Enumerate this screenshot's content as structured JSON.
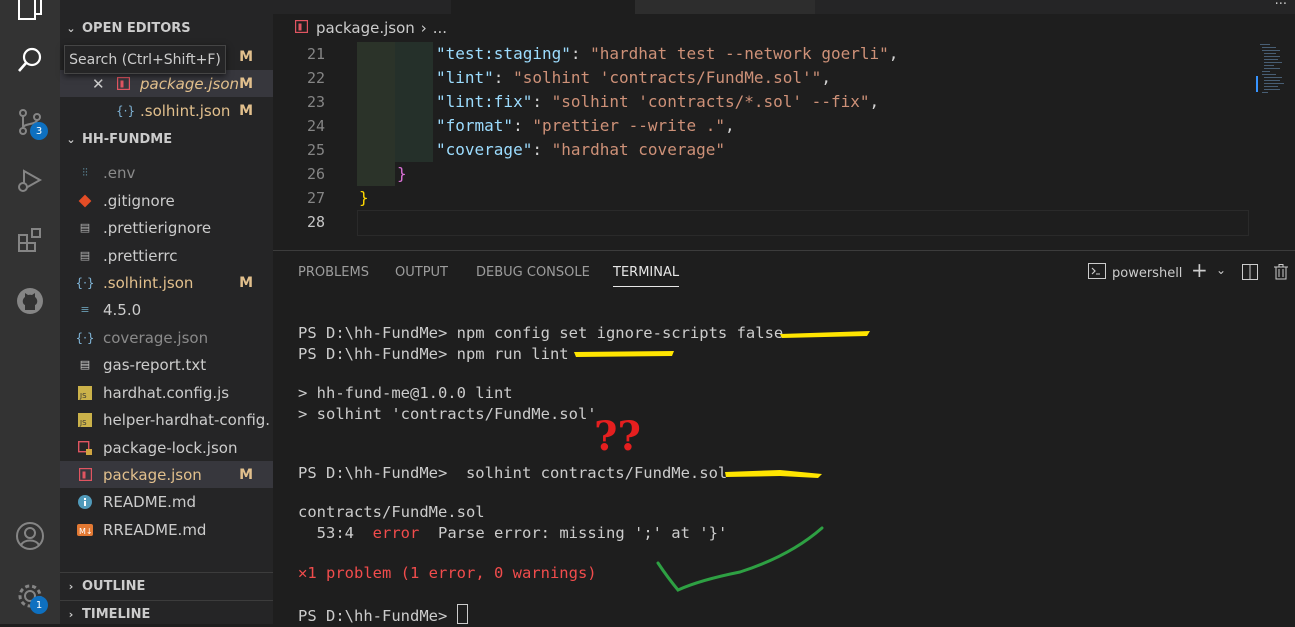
{
  "tooltip": "Search (Ctrl+Shift+F)",
  "activity": {
    "scm_badge": "3",
    "settings_badge": "1"
  },
  "sidebar": {
    "open_editors_title": "OPEN EDITORS",
    "open_editors": [
      {
        "label": "package.json",
        "status": "M",
        "partial_status": "M"
      },
      {
        "label": "package.json",
        "status": "M"
      },
      {
        "label": ".solhint.json",
        "status": "M"
      }
    ],
    "project_title": "HH-FUNDME",
    "files": [
      {
        "label": ".env",
        "status": ""
      },
      {
        "label": ".gitignore",
        "status": ""
      },
      {
        "label": ".prettierignore",
        "status": ""
      },
      {
        "label": ".prettierrc",
        "status": ""
      },
      {
        "label": ".solhint.json",
        "status": "M"
      },
      {
        "label": "4.5.0",
        "status": ""
      },
      {
        "label": "coverage.json",
        "status": ""
      },
      {
        "label": "gas-report.txt",
        "status": ""
      },
      {
        "label": "hardhat.config.js",
        "status": ""
      },
      {
        "label": "helper-hardhat-config...",
        "status": ""
      },
      {
        "label": "package-lock.json",
        "status": ""
      },
      {
        "label": "package.json",
        "status": "M"
      },
      {
        "label": "README.md",
        "status": ""
      },
      {
        "label": "RREADME.md",
        "status": ""
      }
    ],
    "outline_title": "OUTLINE",
    "timeline_title": "TIMELINE"
  },
  "breadcrumb": {
    "file": "package.json",
    "sep": "›",
    "rest": "..."
  },
  "editor": {
    "lines": [
      {
        "num": "21",
        "key": "\"test:staging\"",
        "val": "\"hardhat test --network goerli\"",
        "end": ","
      },
      {
        "num": "22",
        "key": "\"lint\"",
        "val": "\"solhint 'contracts/FundMe.sol'\"",
        "end": ","
      },
      {
        "num": "23",
        "key": "\"lint:fix\"",
        "val": "\"solhint 'contracts/*.sol' --fix\"",
        "end": ","
      },
      {
        "num": "24",
        "key": "\"format\"",
        "val": "\"prettier --write .\"",
        "end": ","
      },
      {
        "num": "25",
        "key": "\"coverage\"",
        "val": "\"hardhat coverage\"",
        "end": ""
      },
      {
        "num": "26",
        "text": "}"
      },
      {
        "num": "27",
        "text": "}"
      },
      {
        "num": "28",
        "text": ""
      }
    ]
  },
  "panel": {
    "tabs": [
      "PROBLEMS",
      "OUTPUT",
      "DEBUG CONSOLE",
      "TERMINAL"
    ],
    "shell": "powershell",
    "terminal": {
      "l1": "PS D:\\hh-FundMe> npm config set ignore-scripts false",
      "l2": "PS D:\\hh-FundMe> npm run lint",
      "l3": "> hh-fund-me@1.0.0 lint",
      "l4": "> solhint 'contracts/FundMe.sol'",
      "l5": "PS D:\\hh-FundMe>  solhint contracts/FundMe.sol",
      "l6": "contracts/FundMe.sol",
      "l7_pos": "  53:4",
      "l7_level": "error",
      "l7_msg": "Parse error: missing ';' at '}'",
      "l8_icon": "✕",
      "l8": "1 problem (1 error, 0 warnings)",
      "l9": "PS D:\\hh-FundMe> "
    }
  },
  "annotations": {
    "marks": "??"
  },
  "colors": {
    "highlight": "#ffe500",
    "check": "#2ea043",
    "marks": "#e51f1f",
    "error": "#f14c4c"
  }
}
